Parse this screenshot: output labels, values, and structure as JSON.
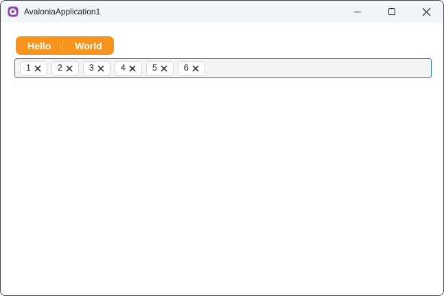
{
  "window": {
    "title": "AvaloniaApplication1"
  },
  "titlebar": {
    "app_icon": "avalonia-logo",
    "buttons": [
      {
        "name": "minimize",
        "icon": "window-minimize-icon"
      },
      {
        "name": "maximize",
        "icon": "window-maximize-icon"
      },
      {
        "name": "close",
        "icon": "window-close-icon"
      }
    ]
  },
  "segmented_buttons": {
    "items": [
      {
        "label": "Hello"
      },
      {
        "label": "World"
      }
    ],
    "background_color": "#F7941E",
    "text_color": "#FFFFFF"
  },
  "chips_field": {
    "border_color": "#2F78AD",
    "background_color": "#F4F4F4",
    "remove_icon": "close-x-icon",
    "chips": [
      {
        "value": "1"
      },
      {
        "value": "2"
      },
      {
        "value": "3"
      },
      {
        "value": "4"
      },
      {
        "value": "5"
      },
      {
        "value": "6"
      }
    ]
  },
  "colors": {
    "titlebar_bg": "#F2F5F9",
    "content_bg": "#FFFFFF",
    "window_border": "#3F3F3F",
    "accent_orange": "#F7941E",
    "field_border_blue": "#2F78AD",
    "avalonia_purple": "#8B44AC"
  }
}
